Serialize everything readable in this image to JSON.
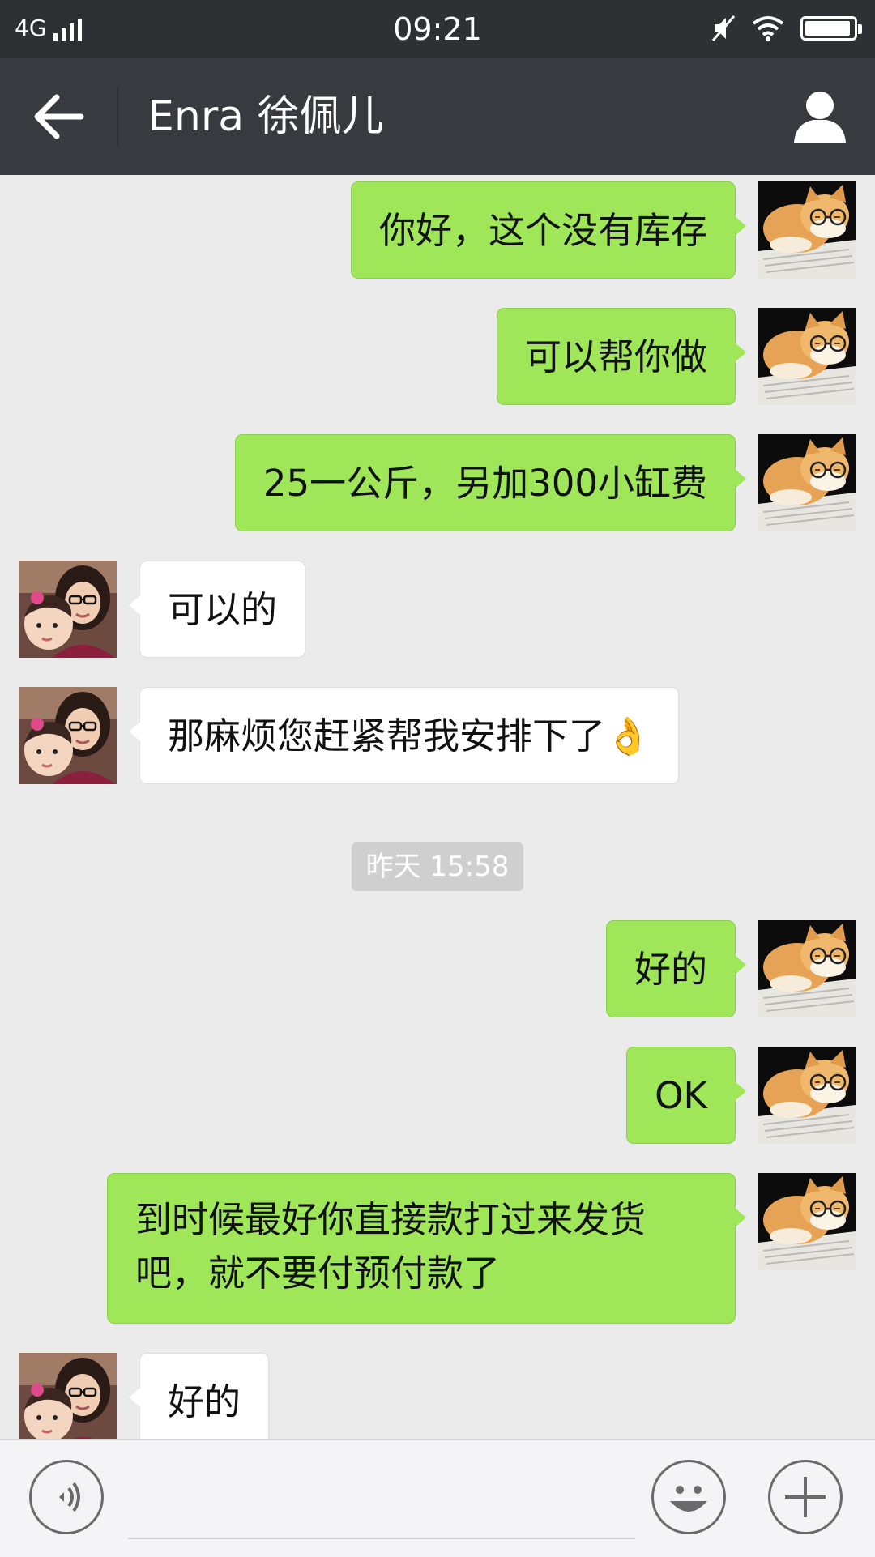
{
  "status_bar": {
    "network": "4G",
    "time": "09:21",
    "battery_level": 0.95
  },
  "header": {
    "title": "Enra 徐佩儿"
  },
  "messages": [
    {
      "side": "me",
      "text": "你好，这个没有库存"
    },
    {
      "side": "me",
      "text": "可以帮你做"
    },
    {
      "side": "me",
      "text": "25一公斤，另加300小缸费"
    },
    {
      "side": "them",
      "text": "可以的"
    },
    {
      "side": "them",
      "text": "那麻烦您赶紧帮我安排下了👌"
    },
    {
      "timestamp": "昨天 15:58"
    },
    {
      "side": "me",
      "text": "好的"
    },
    {
      "side": "me",
      "text": "OK"
    },
    {
      "side": "me",
      "text": "到时候最好你直接款打过来发货吧，就不要付预付款了"
    },
    {
      "side": "them",
      "text": "好的"
    }
  ],
  "input_bar": {
    "placeholder": ""
  },
  "icons": {
    "back": "arrow-left-icon",
    "profile": "person-icon",
    "voice": "voice-icon",
    "emoji": "emoji-icon",
    "more": "plus-icon"
  },
  "colors": {
    "my_bubble": "#9fe658",
    "their_bubble": "#ffffff",
    "header": "#393a3f"
  }
}
